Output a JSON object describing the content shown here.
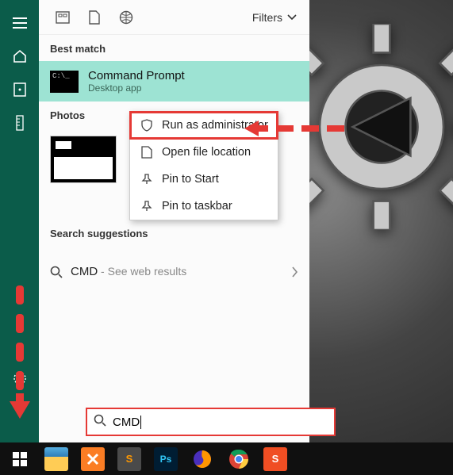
{
  "sidebar": {
    "icons": [
      "menu",
      "home",
      "recent",
      "ruler",
      "settings"
    ]
  },
  "toprow": {
    "filters_label": "Filters"
  },
  "sections": {
    "best_match": "Best match",
    "photos": "Photos",
    "search_suggestions": "Search suggestions"
  },
  "best_match": {
    "title": "Command Prompt",
    "subtitle": "Desktop app",
    "thumb_text": "C:\\_"
  },
  "context_menu": {
    "run_admin": "Run as administrator",
    "open_loc": "Open file location",
    "pin_start": "Pin to Start",
    "pin_task": "Pin to taskbar"
  },
  "suggestion": {
    "term": "CMD",
    "extra": " - See web results"
  },
  "searchbox": {
    "value": "CMD"
  },
  "taskbar_apps": [
    {
      "name": "start",
      "bg": "transparent",
      "label": ""
    },
    {
      "name": "explorer",
      "bg": "#ffcc33",
      "label": ""
    },
    {
      "name": "xampp",
      "bg": "#fb7d24",
      "label": ""
    },
    {
      "name": "sublime",
      "bg": "#4a4a4a",
      "label": "S"
    },
    {
      "name": "photoshop",
      "bg": "#001d33",
      "label": "Ps"
    },
    {
      "name": "firefox",
      "bg": "transparent",
      "label": ""
    },
    {
      "name": "chrome",
      "bg": "transparent",
      "label": ""
    },
    {
      "name": "snagit",
      "bg": "#f04e23",
      "label": "S"
    }
  ]
}
